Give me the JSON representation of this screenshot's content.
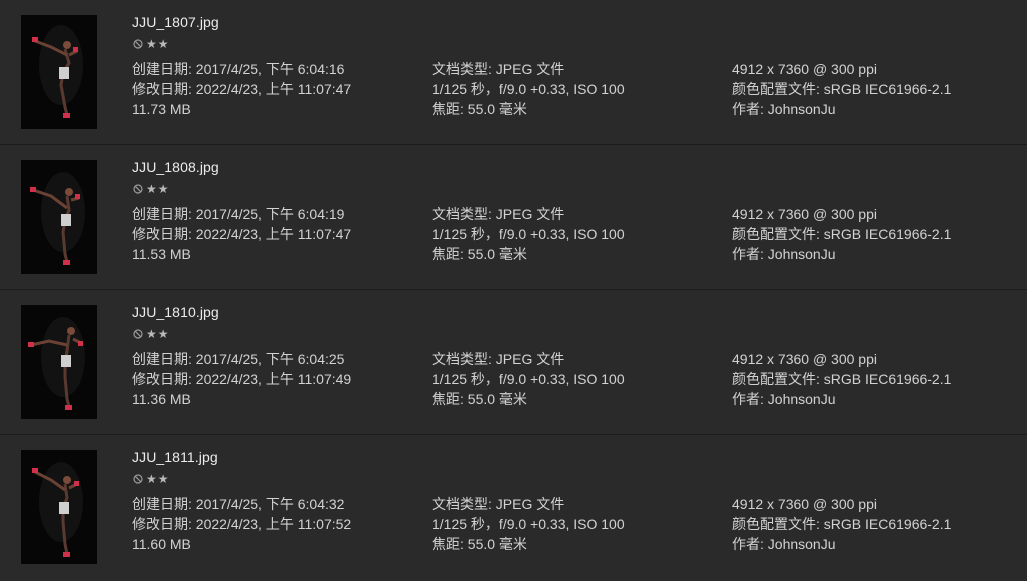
{
  "files": [
    {
      "name": "JJU_1807.jpg",
      "rating": 2,
      "created": "创建日期: 2017/4/25, 下午 6:04:16",
      "modified": "修改日期: 2022/4/23, 上午 11:07:47",
      "size": "11.73 MB",
      "doc_type": "文档类型: JPEG 文件",
      "exposure": "1/125 秒，f/9.0 +0.33, ISO 100",
      "focal": "焦距: 55.0 毫米",
      "dimensions": "4912 x 7360 @ 300 ppi",
      "color_profile": "颜色配置文件: sRGB IEC61966-2.1",
      "author": "作者: JohnsonJu"
    },
    {
      "name": "JJU_1808.jpg",
      "rating": 2,
      "created": "创建日期: 2017/4/25, 下午 6:04:19",
      "modified": "修改日期: 2022/4/23, 上午 11:07:47",
      "size": "11.53 MB",
      "doc_type": "文档类型: JPEG 文件",
      "exposure": "1/125 秒，f/9.0 +0.33, ISO 100",
      "focal": "焦距: 55.0 毫米",
      "dimensions": "4912 x 7360 @ 300 ppi",
      "color_profile": "颜色配置文件: sRGB IEC61966-2.1",
      "author": "作者: JohnsonJu"
    },
    {
      "name": "JJU_1810.jpg",
      "rating": 2,
      "created": "创建日期: 2017/4/25, 下午 6:04:25",
      "modified": "修改日期: 2022/4/23, 上午 11:07:49",
      "size": "11.36 MB",
      "doc_type": "文档类型: JPEG 文件",
      "exposure": "1/125 秒，f/9.0 +0.33, ISO 100",
      "focal": "焦距: 55.0 毫米",
      "dimensions": "4912 x 7360 @ 300 ppi",
      "color_profile": "颜色配置文件: sRGB IEC61966-2.1",
      "author": "作者: JohnsonJu"
    },
    {
      "name": "JJU_1811.jpg",
      "rating": 2,
      "created": "创建日期: 2017/4/25, 下午 6:04:32",
      "modified": "修改日期: 2022/4/23, 上午 11:07:52",
      "size": "11.60 MB",
      "doc_type": "文档类型: JPEG 文件",
      "exposure": "1/125 秒，f/9.0 +0.33, ISO 100",
      "focal": "焦距: 55.0 毫米",
      "dimensions": "4912 x 7360 @ 300 ppi",
      "color_profile": "颜色配置文件: sRGB IEC61966-2.1",
      "author": "作者: JohnsonJu"
    }
  ],
  "icons": {
    "reject": "reject-icon",
    "star": "star-icon"
  },
  "colors": {
    "background": "#2a2a2a",
    "separator": "#1c1c1c",
    "text": "#d2d2d2",
    "accent_red": "#d0304a"
  }
}
